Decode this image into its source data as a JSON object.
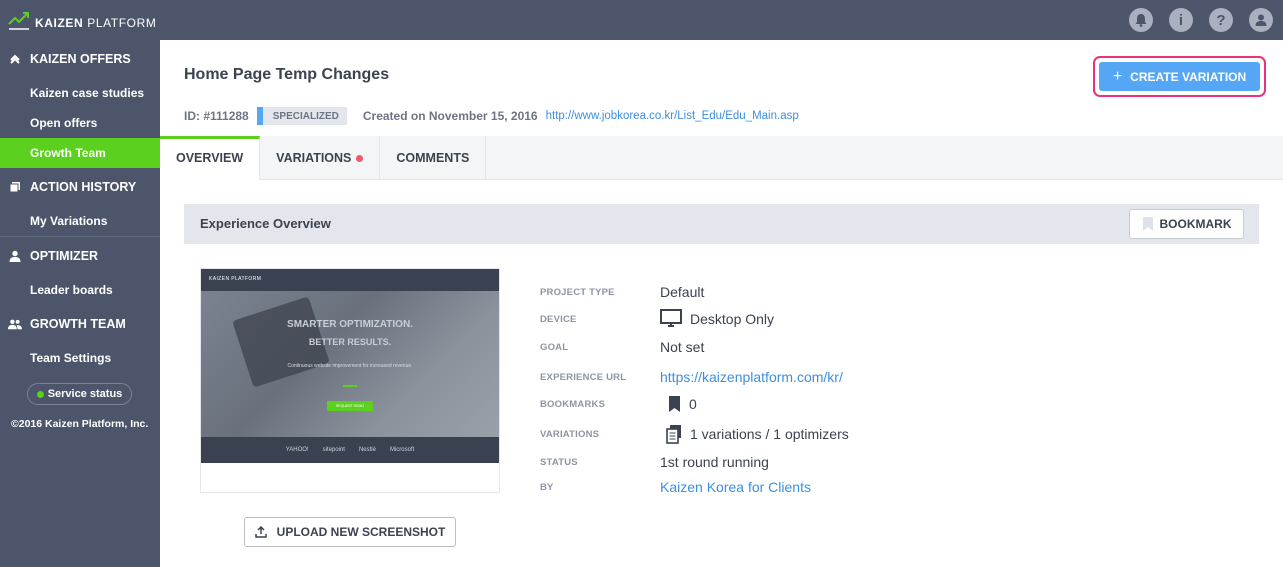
{
  "brand": {
    "name_bold": "KAIZEN",
    "name_rest": "PLATFORM"
  },
  "topbar": {
    "icons": [
      "bell-icon",
      "info-icon",
      "help-icon",
      "user-icon"
    ]
  },
  "sidebar": {
    "sections": [
      {
        "title": "KAIZEN OFFERS",
        "icon": "kaizen-icon",
        "items": [
          "Kaizen case studies",
          "Open offers",
          "Growth Team"
        ]
      },
      {
        "title": "ACTION HISTORY",
        "icon": "copy-icon",
        "items": [
          "My Variations"
        ]
      },
      {
        "title": "OPTIMIZER",
        "icon": "person-icon",
        "items": [
          "Leader boards"
        ]
      },
      {
        "title": "GROWTH TEAM",
        "icon": "people-icon",
        "items": [
          "Team Settings"
        ]
      }
    ],
    "active_item": "Growth Team",
    "service_status": "Service status",
    "copyright": "©2016 Kaizen Platform, Inc."
  },
  "header": {
    "title": "Home Page Temp Changes",
    "create_button": "CREATE VARIATION",
    "id_label": "ID: #111288",
    "badge": "SPECIALIZED",
    "created": "Created on November 15, 2016",
    "url": "http://www.jobkorea.co.kr/List_Edu/Edu_Main.asp"
  },
  "tabs": [
    "OVERVIEW",
    "VARIATIONS",
    "COMMENTS"
  ],
  "overview": {
    "title": "Experience Overview",
    "bookmark_button": "BOOKMARK",
    "upload_button": "UPLOAD NEW SCREENSHOT",
    "screenshot": {
      "brand": "KAIZEN PLATFORM",
      "headline1": "SMARTER OPTIMIZATION.",
      "headline2": "BETTER RESULTS.",
      "subline": "Continuous website improvement for increased revenue.",
      "cta": "REQUEST DEMO",
      "logos": [
        "YAHOO!",
        "sitepoint",
        "Nestlé",
        "Microsoft"
      ]
    },
    "details": [
      {
        "label": "PROJECT TYPE",
        "value": "Default"
      },
      {
        "label": "DEVICE",
        "value": "Desktop Only",
        "icon": "monitor-icon"
      },
      {
        "label": "GOAL",
        "value": "Not set"
      },
      {
        "label": "EXPERIENCE URL",
        "value": "https://kaizenplatform.com/kr/",
        "link": true
      },
      {
        "label": "BOOKMARKS",
        "value": "0",
        "icon": "bookmark-icon"
      },
      {
        "label": "VARIATIONS",
        "value": "1 variations / 1 optimizers",
        "icon": "variations-icon"
      },
      {
        "label": "STATUS",
        "value": "1st round running"
      },
      {
        "label": "BY",
        "value": "Kaizen Korea for Clients",
        "link": true
      }
    ]
  },
  "colors": {
    "sidebar": "#4c556a",
    "accent_green": "#5cd01e",
    "primary_blue": "#55a6f4",
    "highlight_pink": "#e8337a",
    "link": "#3d8fe0"
  }
}
